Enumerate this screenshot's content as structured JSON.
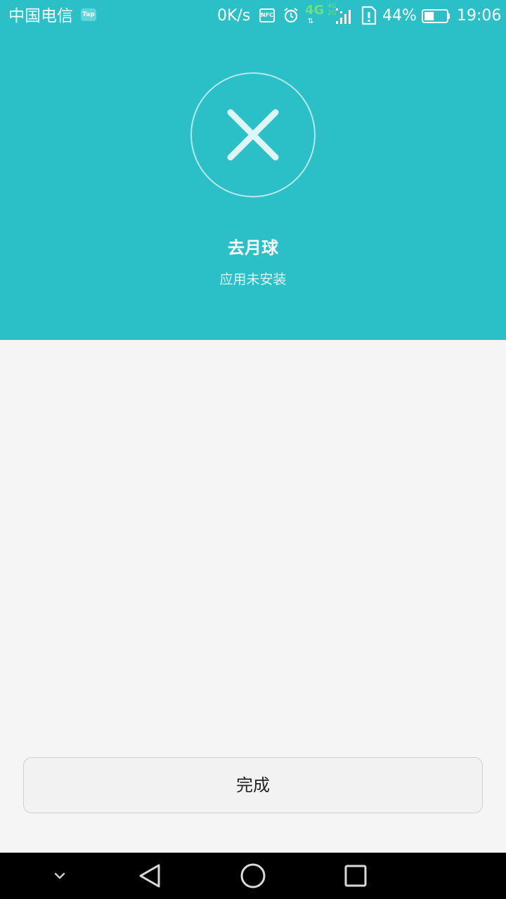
{
  "status_bar": {
    "carrier": "中国电信",
    "tap_badge": "Tap",
    "network_speed": "0K/s",
    "nfc": "NFC",
    "network_type": "4G",
    "secondary_network": "4G\n2G",
    "battery_percent": "44%",
    "battery_level": 0.44,
    "time": "19:06"
  },
  "install_result": {
    "app_name": "去月球",
    "status": "应用未安装"
  },
  "actions": {
    "done_label": "完成"
  },
  "icons": {
    "fail": "close-icon",
    "nav_collapse": "chevron-down-icon",
    "nav_back": "back-triangle-icon",
    "nav_home": "home-circle-icon",
    "nav_recents": "recents-square-icon"
  },
  "colors": {
    "header_bg": "#2bbfc7",
    "page_bg": "#f5f5f5",
    "network_green": "#6ee27a"
  }
}
